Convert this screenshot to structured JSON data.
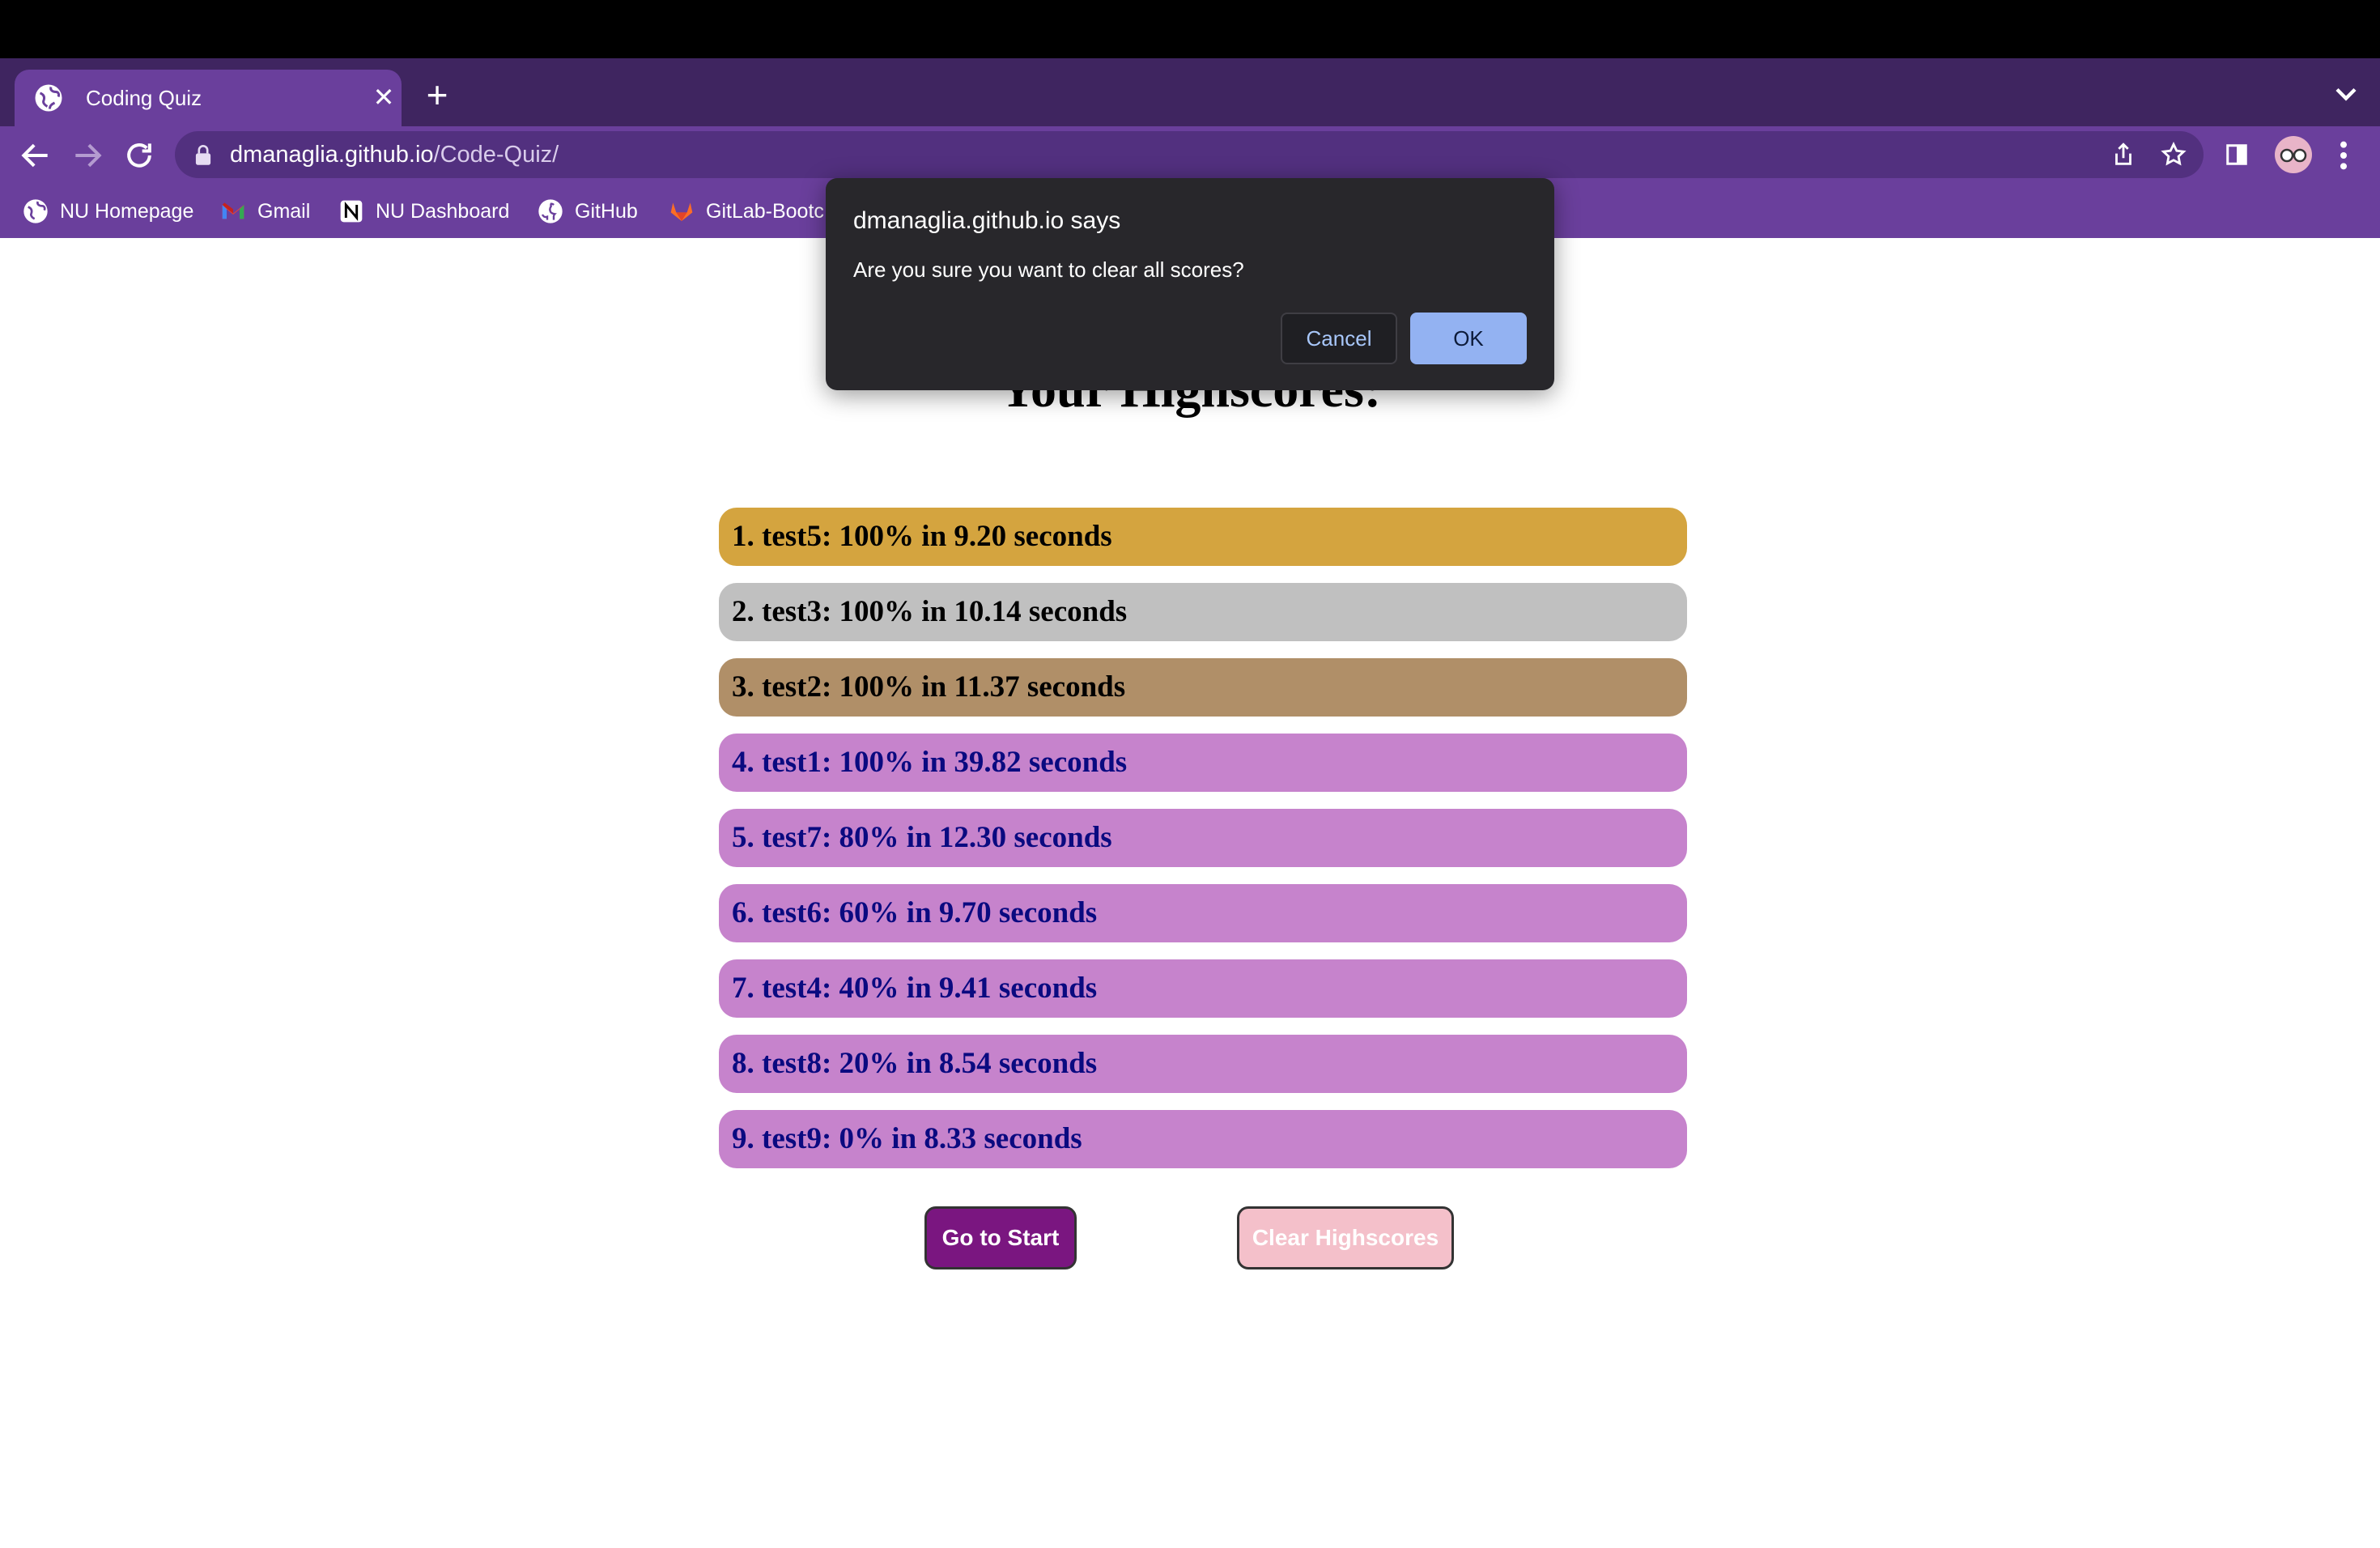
{
  "browser": {
    "tab_title": "Coding Quiz",
    "url_host": "dmanaglia.github.io",
    "url_path": "/Code-Quiz/",
    "bookmarks": [
      {
        "label": "NU Homepage",
        "icon": "globe-icon"
      },
      {
        "label": "Gmail",
        "icon": "gmail-icon"
      },
      {
        "label": "NU Dashboard",
        "icon": "notion-icon"
      },
      {
        "label": "GitHub",
        "icon": "github-icon"
      },
      {
        "label": "GitLab-Bootc",
        "icon": "gitlab-icon"
      }
    ]
  },
  "page": {
    "heading": "Your Highscores:",
    "scores": [
      {
        "text": "1. test5: 100% in 9.20 seconds",
        "bg": "#d4a43f",
        "color": "#000000"
      },
      {
        "text": "2. test3: 100% in 10.14 seconds",
        "bg": "#c0c0c0",
        "color": "#000000"
      },
      {
        "text": "3. test2: 100% in 11.37 seconds",
        "bg": "#b08f68",
        "color": "#000000"
      },
      {
        "text": "4. test1: 100% in 39.82 seconds",
        "bg": "#c683cc",
        "color": "#0a0a80"
      },
      {
        "text": "5. test7: 80% in 12.30 seconds",
        "bg": "#c683cc",
        "color": "#0a0a80"
      },
      {
        "text": "6. test6: 60% in 9.70 seconds",
        "bg": "#c683cc",
        "color": "#0a0a80"
      },
      {
        "text": "7. test4: 40% in 9.41 seconds",
        "bg": "#c683cc",
        "color": "#0a0a80"
      },
      {
        "text": "8. test8: 20% in 8.54 seconds",
        "bg": "#c683cc",
        "color": "#0a0a80"
      },
      {
        "text": "9. test9: 0% in 8.33 seconds",
        "bg": "#c683cc",
        "color": "#0a0a80"
      }
    ],
    "go_to_start_label": "Go to Start",
    "clear_highscores_label": "Clear Highscores"
  },
  "dialog": {
    "title": "dmanaglia.github.io says",
    "message": "Are you sure you want to clear all scores?",
    "cancel_label": "Cancel",
    "ok_label": "OK"
  },
  "colors": {
    "chrome_purple": "#6a3f9c",
    "tabstrip_purple": "#3f2560",
    "dialog_bg": "#28272b",
    "ok_button": "#93b2f2",
    "start_button": "#7a1680",
    "clear_button": "#f4c0ca"
  }
}
